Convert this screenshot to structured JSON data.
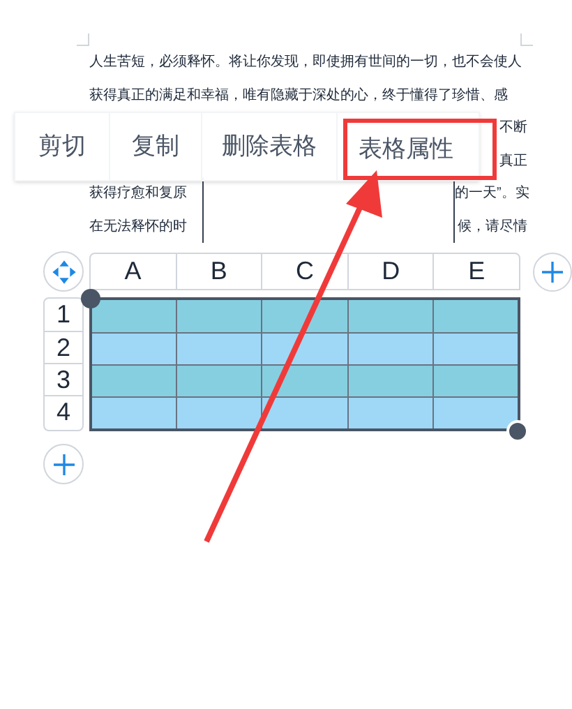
{
  "document": {
    "lines": [
      {
        "left": "人生苦短，必须释怀。将让你发现，即使拥有世间的一切，也不会使人"
      },
      {
        "left": "获得真正的满足和幸福，唯有隐藏于深处的心，终于懂得了珍惜、感"
      },
      {
        "right": "不断"
      },
      {
        "right": "真正"
      },
      {
        "left": "获得疗愈和复原",
        "right": "的一天”。实"
      },
      {
        "left": "在无法释怀的时",
        "right": "候，请尽情"
      }
    ]
  },
  "context_menu": {
    "items": [
      {
        "label": "剪切",
        "highlighted": false
      },
      {
        "label": "复制",
        "highlighted": false
      },
      {
        "label": "删除表格",
        "highlighted": false
      },
      {
        "label": "表格属性",
        "highlighted": true
      }
    ]
  },
  "table": {
    "columns": [
      "A",
      "B",
      "C",
      "D",
      "E"
    ],
    "rows": [
      "1",
      "2",
      "3",
      "4"
    ]
  }
}
